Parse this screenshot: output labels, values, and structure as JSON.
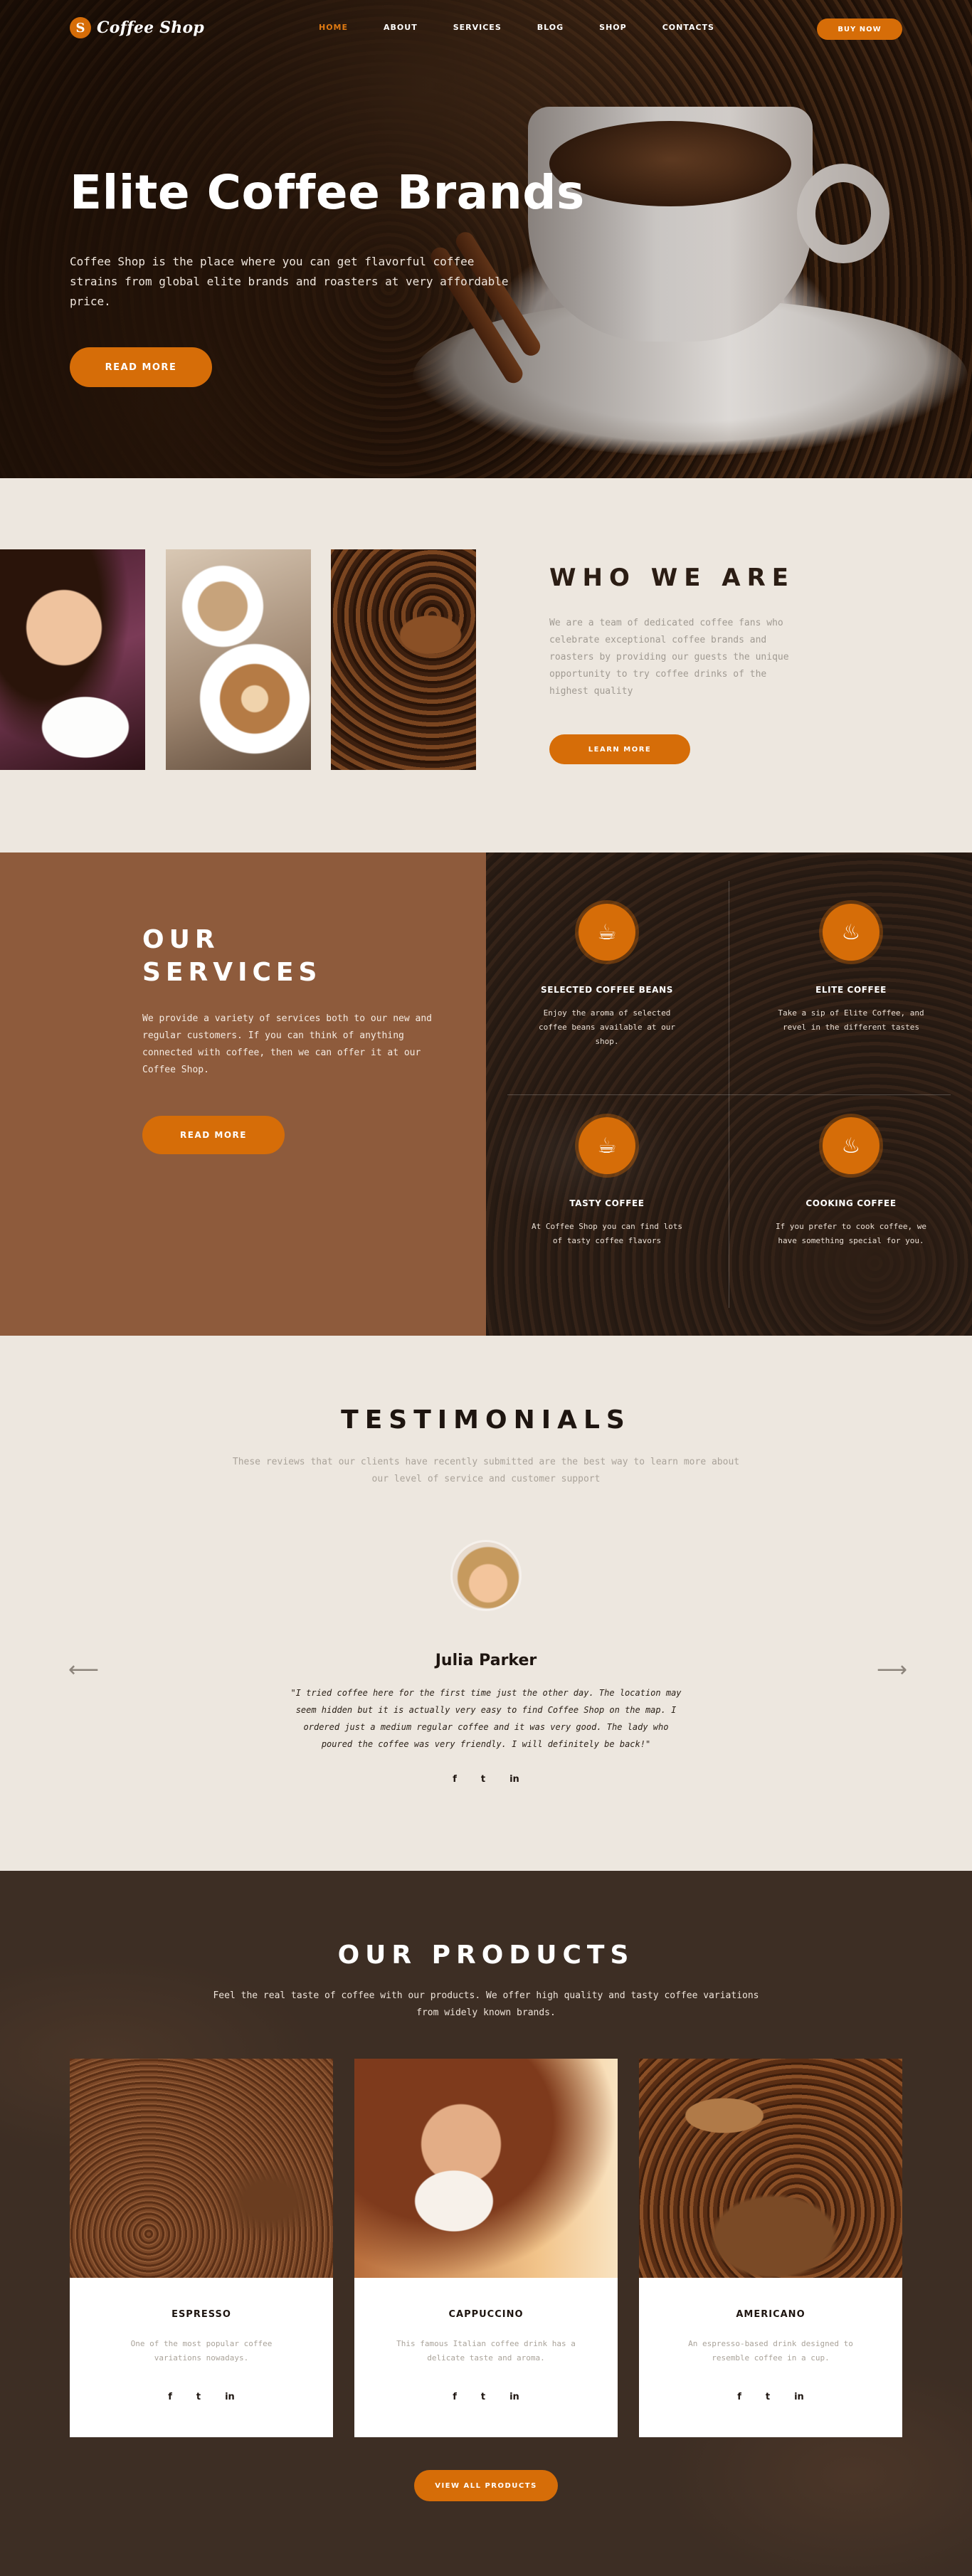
{
  "brand": {
    "name": "Coffee Shop",
    "logo_letter": "S"
  },
  "nav": {
    "items": [
      "HOME",
      "ABOUT",
      "SERVICES",
      "BLOG",
      "SHOP",
      "CONTACTS"
    ],
    "active": "HOME",
    "buy_label": "BUY NOW"
  },
  "hero": {
    "title": "Elite Coffee Brands",
    "text": "Coffee Shop is the place where you can get flavorful coffee strains from global elite brands and roasters at very affordable price.",
    "button": "READ MORE"
  },
  "about": {
    "title": "WHO WE ARE",
    "text": "We are a team of dedicated coffee fans who celebrate exceptional coffee brands and roasters by providing our guests the unique opportunity to try coffee drinks of the highest quality",
    "button": "LEARN MORE"
  },
  "services": {
    "title_line1": "OUR",
    "title_line2": "SERVICES",
    "text": "We provide a variety of services both to our new and regular customers. If you can think of anything connected with coffee, then we can offer it at our Coffee Shop.",
    "button": "READ MORE",
    "items": [
      {
        "title": "SELECTED COFFEE BEANS",
        "text": "Enjoy the aroma of selected coffee beans available at our shop.",
        "icon": "coffee-beans-icon"
      },
      {
        "title": "ELITE COFFEE",
        "text": "Take a sip of Elite Coffee, and revel in the different tastes",
        "icon": "coffee-bag-icon"
      },
      {
        "title": "TASTY COFFEE",
        "text": "At Coffee Shop you can find lots of tasty coffee flavors",
        "icon": "coffee-pot-icon"
      },
      {
        "title": "COOKING COFFEE",
        "text": "If you prefer to cook coffee, we have something special for you.",
        "icon": "turkish-pot-icon"
      }
    ]
  },
  "testimonials": {
    "title": "TESTIMONIALS",
    "subtitle": "These reviews that our clients have recently submitted are the best way to learn more about our level of service and customer support",
    "name": "Julia Parker",
    "quote": "\"I tried coffee here for the first time just the other day. The location may seem hidden but it is actually very easy to find Coffee Shop on the map. I ordered just a medium regular coffee and it was very good. The lady who poured the coffee was very friendly. I will definitely be back!\"",
    "prev": "⟵",
    "next": "⟶",
    "social": [
      "f",
      "t",
      "in"
    ]
  },
  "products": {
    "title": "OUR PRODUCTS",
    "subtitle": "Feel the real taste of coffee with our products. We offer high quality and tasty coffee variations from widely known brands.",
    "items": [
      {
        "title": "ESPRESSO",
        "text": "One of the most popular coffee variations nowadays."
      },
      {
        "title": "CAPPUCCINO",
        "text": "This famous Italian coffee drink has a delicate taste and aroma."
      },
      {
        "title": "AMERICANO",
        "text": "An espresso-based drink designed to resemble coffee in a cup."
      }
    ],
    "social": [
      "f",
      "t",
      "in"
    ],
    "button": "VIEW ALL PRODUCTS"
  },
  "colors": {
    "accent": "#d66d08",
    "services_bg": "#8e5b3c",
    "light_bg": "#ede7df",
    "dark_bg": "#3d2e24"
  }
}
